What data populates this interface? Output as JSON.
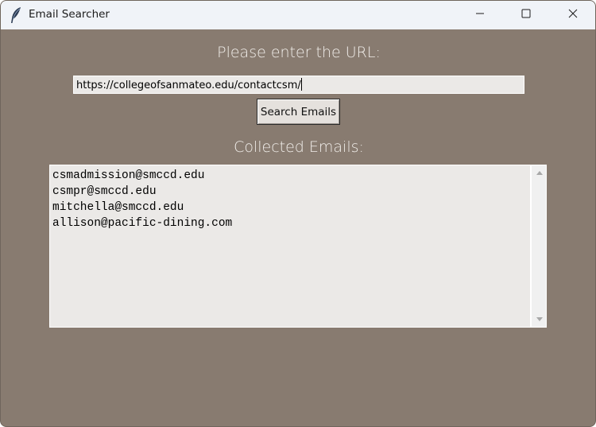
{
  "window": {
    "title": "Email Searcher"
  },
  "form": {
    "prompt_label": "Please enter the URL:",
    "url_value": "https://collegeofsanmateo.edu/contactcsm/",
    "search_button_label": "Search Emails"
  },
  "results": {
    "label": "Collected Emails:",
    "emails": [
      "csmadmission@smccd.edu",
      "csmpr@smccd.edu",
      "mitchella@smccd.edu",
      "allison@pacific-dining.com"
    ]
  },
  "icons": {
    "app": "feather-icon",
    "minimize": "minimize-icon",
    "maximize": "maximize-icon",
    "close": "close-icon",
    "scroll_up": "chevron-up-icon",
    "scroll_down": "chevron-down-icon"
  },
  "colors": {
    "background": "#887b70",
    "titlebar": "#f0f3f8",
    "field": "#ebe9e7",
    "label_text": "#f1eeea"
  }
}
